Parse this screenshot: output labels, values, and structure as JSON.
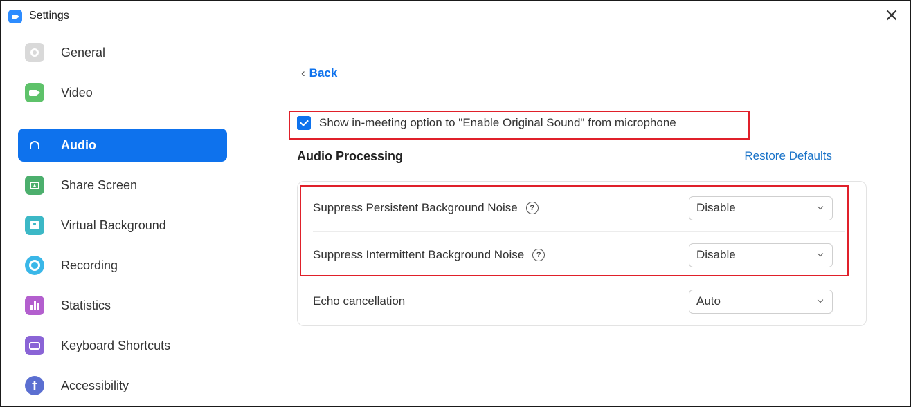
{
  "window": {
    "title": "Settings",
    "close_glyph": "×"
  },
  "sidebar": {
    "items": [
      {
        "label": "General",
        "icon": "gear-icon"
      },
      {
        "label": "Video",
        "icon": "camera-icon"
      },
      {
        "label": "Audio",
        "icon": "headphones-icon",
        "active": true
      },
      {
        "label": "Share Screen",
        "icon": "share-screen-icon"
      },
      {
        "label": "Virtual Background",
        "icon": "virtual-background-icon"
      },
      {
        "label": "Recording",
        "icon": "recording-icon"
      },
      {
        "label": "Statistics",
        "icon": "statistics-icon"
      },
      {
        "label": "Keyboard Shortcuts",
        "icon": "keyboard-icon"
      },
      {
        "label": "Accessibility",
        "icon": "accessibility-icon"
      }
    ]
  },
  "content": {
    "back_label": "Back",
    "original_sound": {
      "label": "Show in-meeting option to \"Enable Original Sound\" from microphone",
      "checked": true
    },
    "section_title": "Audio Processing",
    "restore_label": "Restore Defaults",
    "settings": [
      {
        "label": "Suppress Persistent Background Noise",
        "value": "Disable",
        "has_help": true
      },
      {
        "label": "Suppress Intermittent Background Noise",
        "value": "Disable",
        "has_help": true
      },
      {
        "label": "Echo cancellation",
        "value": "Auto",
        "has_help": false
      }
    ]
  },
  "colors": {
    "accent": "#0e72ed",
    "highlight": "#e0202a",
    "link": "#1a73c8"
  }
}
